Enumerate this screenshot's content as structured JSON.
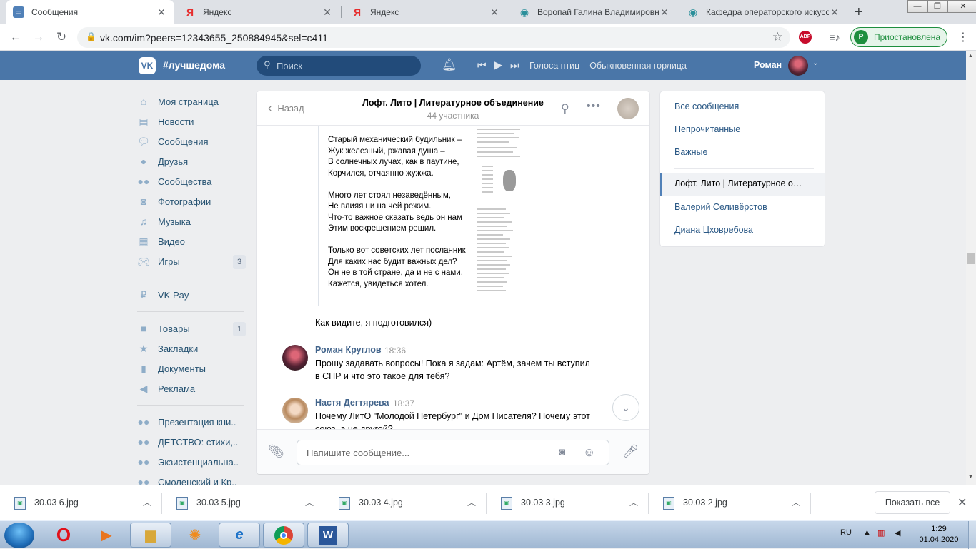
{
  "browser": {
    "tabs": [
      {
        "title": "Сообщения",
        "close": "✕"
      },
      {
        "title": "Яндекс",
        "close": "✕"
      },
      {
        "title": "Яндекс",
        "close": "✕"
      },
      {
        "title": "Воропай Галина Владимировна",
        "close": "✕"
      },
      {
        "title": "Кафедра операторского искусства",
        "close": "✕"
      }
    ],
    "new_tab": "+",
    "window_controls": {
      "minimize": "—",
      "maximize": "❐",
      "close": "✕"
    },
    "url": "vk.com/im?peers=12343655_250884945&sel=c411",
    "abp_label": "ABP",
    "profile_initial": "P",
    "profile_status": "Приостановлена"
  },
  "vk_header": {
    "logo": "VK",
    "tag": "#лучшедома",
    "search_placeholder": "Поиск",
    "track": "Голоса птиц – Обыкновенная горлица",
    "user_name": "Роман"
  },
  "left_nav": {
    "items": [
      {
        "label": "Моя страница",
        "icon": "home-icon"
      },
      {
        "label": "Новости",
        "icon": "news-icon"
      },
      {
        "label": "Сообщения",
        "icon": "messages-icon"
      },
      {
        "label": "Друзья",
        "icon": "friend-icon"
      },
      {
        "label": "Сообщества",
        "icon": "groups-icon"
      },
      {
        "label": "Фотографии",
        "icon": "camera-icon"
      },
      {
        "label": "Музыка",
        "icon": "music-icon"
      },
      {
        "label": "Видео",
        "icon": "video-icon"
      },
      {
        "label": "Игры",
        "icon": "gamepad-icon",
        "count": "3"
      }
    ],
    "items2": [
      {
        "label": "VK Pay",
        "icon": "vkpay-icon"
      }
    ],
    "items3": [
      {
        "label": "Товары",
        "icon": "shopping-bag-icon",
        "count": "1"
      },
      {
        "label": "Закладки",
        "icon": "star-icon"
      },
      {
        "label": "Документы",
        "icon": "document-icon"
      },
      {
        "label": "Реклама",
        "icon": "megaphone-icon"
      }
    ],
    "items4": [
      {
        "label": "Презентация кни..",
        "icon": "groups-icon"
      },
      {
        "label": "ДЕТСТВО: стихи,..",
        "icon": "groups-icon"
      },
      {
        "label": "Экзистенциальна..",
        "icon": "groups-icon"
      },
      {
        "label": "Смоленский и Кр..",
        "icon": "groups-icon"
      }
    ]
  },
  "chat": {
    "back_label": "Назад",
    "title": "Лофт. Лито | Литературное объединение",
    "subtitle": "44 участника",
    "poem": [
      "Старый механический будильник –\nЖук железный, ржавая душа –\nВ солнечных лучах, как в паутине,\nКорчился, отчаянно жужжа.",
      "Много лет стоял незаведённым,\nНе влияя ни на чей режим.\nЧто-то важное сказать ведь он нам\nЭтим воскрешением решил.",
      "Только вот советских лет посланник\nДля каких нас будит важных дел?\nОн не в той стране, да и не с нами,\nКажется, увидеться хотел."
    ],
    "after_poem_text": "Как видите, я подготовился)",
    "messages": [
      {
        "author": "Роман Круглов",
        "time": "18:36",
        "text": "Прошу задавать вопросы! Пока я задам: Артём, зачем ты вступил в СПР и что это такое для тебя?"
      },
      {
        "author": "Настя Дегтярева",
        "time": "18:37",
        "text": "Почему ЛитО \"Молодой Петербург\" и Дом Писателя? Почему этот союз, а не другой?"
      }
    ],
    "input_placeholder": "Напишите сообщение..."
  },
  "right_panel": {
    "items": [
      "Все сообщения",
      "Непрочитанные",
      "Важные"
    ],
    "selected": "Лофт. Лито | Литературное объединение",
    "items_after": [
      "Валерий Селивёрстов",
      "Диана Цховребова"
    ]
  },
  "downloads": {
    "files": [
      "30.03 6.jpg",
      "30.03 5.jpg",
      "30.03 4.jpg",
      "30.03 3.jpg",
      "30.03 2.jpg"
    ],
    "show_all": "Показать все"
  },
  "taskbar": {
    "lang": "RU",
    "time": "1:29",
    "date": "01.04.2020"
  },
  "colors": {
    "vk_blue": "#4a76a8",
    "link": "#2a5885",
    "author": "#42648b",
    "profile_green": "#1e8e3e"
  }
}
